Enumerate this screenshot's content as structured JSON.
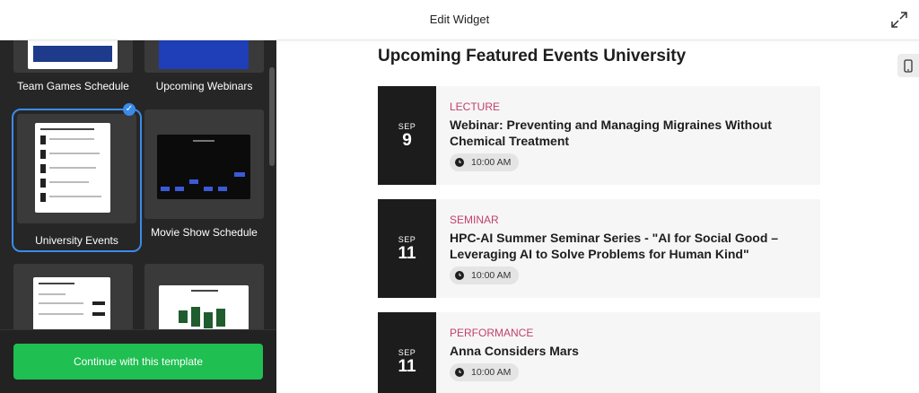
{
  "header": {
    "title": "Edit Widget"
  },
  "templates": [
    {
      "label": "Team Games Schedule"
    },
    {
      "label": "Upcoming Webinars"
    },
    {
      "label": "University Events",
      "selected": true
    },
    {
      "label": "Movie Show Schedule"
    },
    {
      "label": ""
    },
    {
      "label": ""
    }
  ],
  "continue_label": "Continue with this template",
  "widget": {
    "title": "Upcoming Featured Events University",
    "events": [
      {
        "month": "SEP",
        "day": "9",
        "category": "LECTURE",
        "title": "Webinar: Preventing and Managing Migraines Without Chemical Treatment",
        "time": "10:00 AM"
      },
      {
        "month": "SEP",
        "day": "11",
        "category": "SEMINAR",
        "title": "HPC-AI Summer Seminar Series - \"AI for Social Good – Leveraging AI to Solve Problems for Human Kind\"",
        "time": "10:00 AM"
      },
      {
        "month": "SEP",
        "day": "11",
        "category": "PERFORMANCE",
        "title": "Anna Considers Mars",
        "time": "10:00 AM"
      }
    ]
  },
  "colors": {
    "accent_blue": "#3b8be8",
    "cta_green": "#1fbf52",
    "category_pink": "#c2416a",
    "panel_dark": "#262626"
  },
  "icons": [
    "expand-icon",
    "mobile-device-icon",
    "check-icon",
    "clock-icon"
  ]
}
